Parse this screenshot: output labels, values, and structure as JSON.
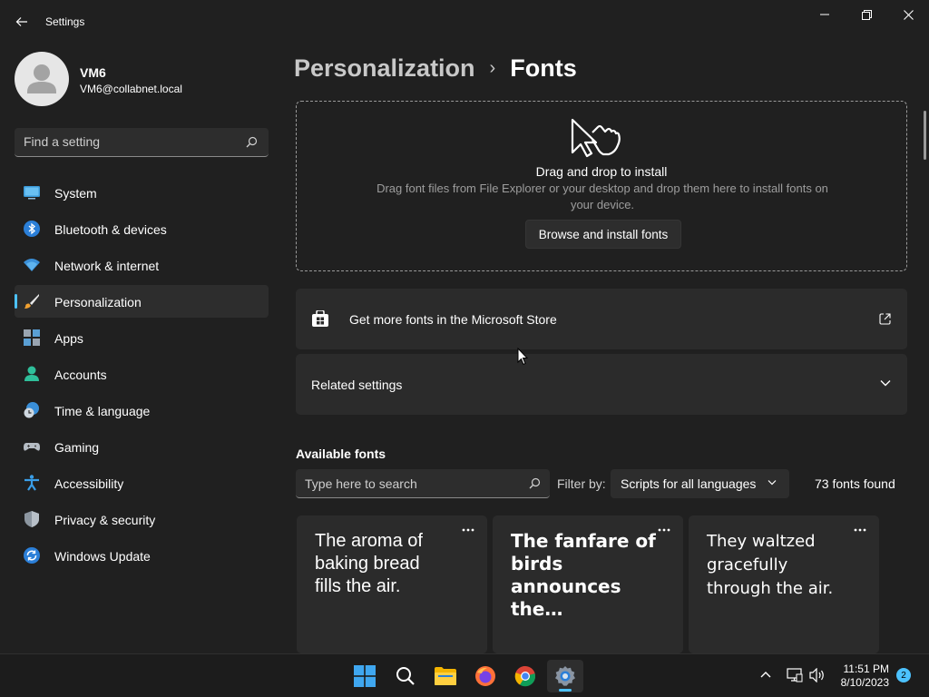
{
  "window": {
    "app_title": "Settings"
  },
  "profile": {
    "name": "VM6",
    "email": "VM6@collabnet.local"
  },
  "search": {
    "placeholder": "Find a setting"
  },
  "sidebar": {
    "items": [
      {
        "label": "System",
        "icon": "system-icon"
      },
      {
        "label": "Bluetooth & devices",
        "icon": "bluetooth-icon"
      },
      {
        "label": "Network & internet",
        "icon": "wifi-icon"
      },
      {
        "label": "Personalization",
        "icon": "brush-icon",
        "active": true
      },
      {
        "label": "Apps",
        "icon": "apps-icon"
      },
      {
        "label": "Accounts",
        "icon": "accounts-icon"
      },
      {
        "label": "Time & language",
        "icon": "globe-clock-icon"
      },
      {
        "label": "Gaming",
        "icon": "gamepad-icon"
      },
      {
        "label": "Accessibility",
        "icon": "accessibility-icon"
      },
      {
        "label": "Privacy & security",
        "icon": "shield-icon"
      },
      {
        "label": "Windows Update",
        "icon": "update-icon"
      }
    ]
  },
  "breadcrumb": {
    "parent": "Personalization",
    "separator": "›",
    "current": "Fonts"
  },
  "drop_zone": {
    "title": "Drag and drop to install",
    "description": "Drag font files from File Explorer or your desktop and drop them here to install fonts on your device.",
    "button": "Browse and install fonts"
  },
  "store": {
    "label": "Get more fonts in the Microsoft Store"
  },
  "related": {
    "label": "Related settings"
  },
  "available": {
    "title": "Available fonts",
    "search_placeholder": "Type here to search",
    "filter_label": "Filter by:",
    "filter_value": "Scripts for all languages",
    "count": "73 fonts found",
    "cards": [
      {
        "sample": "The aroma of baking bread fills the air."
      },
      {
        "sample": "The fanfare of birds announces the…"
      },
      {
        "sample": "They waltzed gracefully through the air."
      }
    ]
  },
  "taskbar": {
    "apps": [
      "start-icon",
      "search-icon",
      "file-explorer-icon",
      "firefox-icon",
      "chrome-icon",
      "settings-icon"
    ],
    "time": "11:51 PM",
    "date": "8/10/2023",
    "notifications": "2"
  },
  "colors": {
    "accent": "#4cc2ff",
    "background": "#202020",
    "card": "#2b2b2b"
  }
}
